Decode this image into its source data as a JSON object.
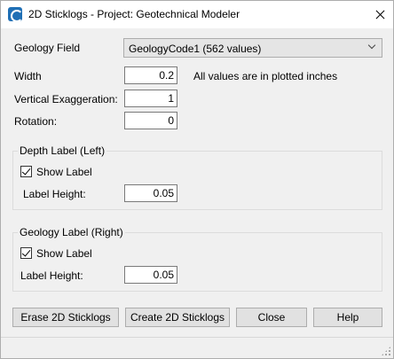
{
  "window": {
    "title": "2D Sticklogs - Project: Geotechnical Modeler"
  },
  "fields": {
    "geology_field_label": "Geology Field",
    "geology_field_value": "GeologyCode1 (562 values)",
    "width_label": "Width",
    "width_value": "0.2",
    "width_note": "All values are in plotted inches",
    "vertical_exaggeration_label": "Vertical Exaggeration:",
    "vertical_exaggeration_value": "1",
    "rotation_label": "Rotation:",
    "rotation_value": "0"
  },
  "depth_label_group": {
    "title": "Depth Label (Left)",
    "show_label": "Show Label",
    "show_label_checked": true,
    "label_height_label": "Label Height:",
    "label_height_value": "0.05"
  },
  "geology_label_group": {
    "title": "Geology Label (Right)",
    "show_label": "Show Label",
    "show_label_checked": true,
    "label_height_label": "Label Height:",
    "label_height_value": "0.05"
  },
  "buttons": {
    "erase": "Erase 2D Sticklogs",
    "create": "Create 2D Sticklogs",
    "close": "Close",
    "help": "Help"
  }
}
